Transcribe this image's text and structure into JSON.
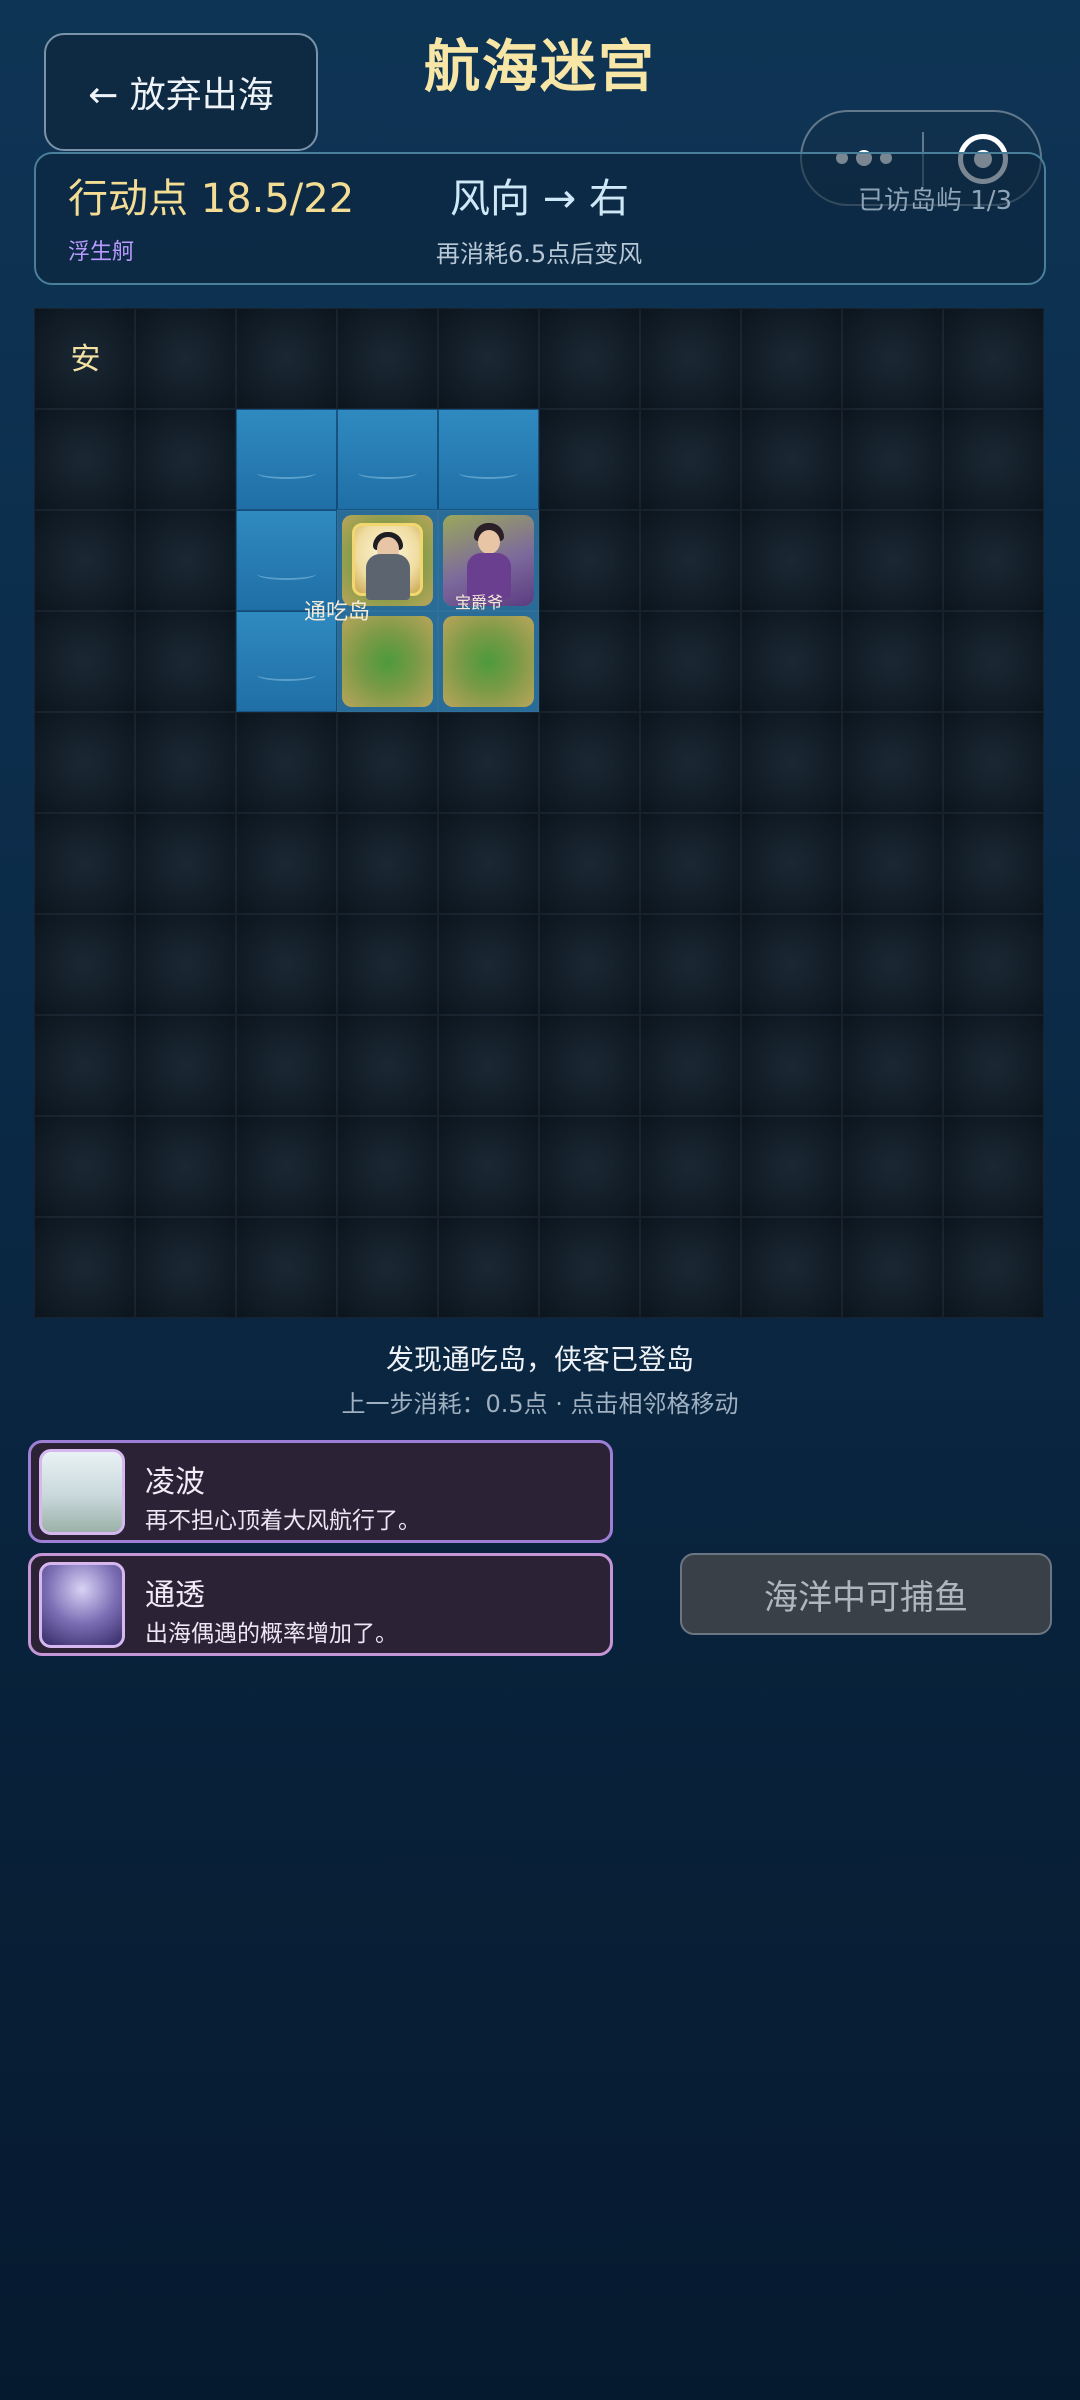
{
  "header": {
    "back_label": "← 放弃出海",
    "title": "航海迷宫"
  },
  "status": {
    "action_points": "行动点 18.5/22",
    "boat": "浮生舸",
    "wind": "风向 → 右",
    "wind_change": "再消耗6.5点后变风",
    "visited": "已访岛屿 1/3"
  },
  "map": {
    "rows": 10,
    "cols": 10,
    "safe_label": "安",
    "island_name": "通吃岛",
    "character_label": "宝爵爷"
  },
  "messages": {
    "main": "发现通吃岛，侠客已登岛",
    "sub": "上一步消耗：0.5点 · 点击相邻格移动"
  },
  "buffs": [
    {
      "name": "凌波",
      "desc": "再不担心顶着大风航行了。"
    },
    {
      "name": "通透",
      "desc": "出海偶遇的概率增加了。"
    }
  ],
  "fish_button": "海洋中可捕鱼",
  "colors": {
    "title_gold": "#f7e6a6",
    "sea_blue": "#2f8ac0",
    "buff_border": "#9d7fd6"
  }
}
